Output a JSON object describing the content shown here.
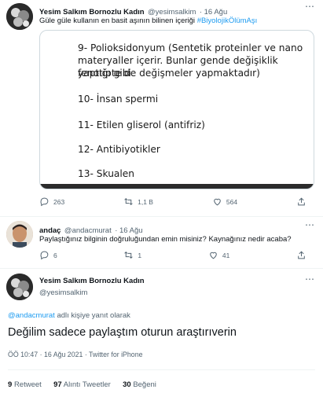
{
  "tweet1": {
    "author_name": "Yesim Salkım Bornozlu Kadın",
    "author_handle": "@yesimsalkim",
    "date_sep": "· 16 Ağu",
    "text": "Güle güle kullanın en basit aşının bilinen içeriği",
    "hashtag": "#BiyolojikÖlümAşı",
    "image_lines": [
      "9- Polioksidonyum (Sentetik proteinler ve nano",
      "materyaller içerir. Bunlar gende değişiklik yaptığı gibi",
      "fenotipte de değişmeler yapmaktadır)",
      "10- İnsan spermi",
      "11- Etilen gliserol (antifriz)",
      "12- Antibiyotikler",
      "13- Skualen"
    ],
    "replies": "263",
    "retweets": "1,1 B",
    "likes": "564"
  },
  "tweet2": {
    "author_name": "andaç",
    "author_handle": "@andacmurat",
    "date_sep": "· 16 Ağu",
    "text": "Paylaştığınız bilginin doğruluğundan emin misiniz? Kaynağınız nedir acaba?",
    "replies": "6",
    "retweets": "1",
    "likes": "41"
  },
  "tweet3": {
    "author_name": "Yesim Salkım Bornozlu Kadın",
    "author_handle": "@yesimsalkim",
    "reply_to_handle": "@andacmurat",
    "reply_to_suffix": "adlı kişiye yanıt olarak",
    "text": "Değilim sadece paylaştım oturun araştırıverin",
    "timestamp": "ÖÖ 10:47 · 16 Ağu 2021 · Twitter for iPhone",
    "retweets_count": "9",
    "retweets_label": "Retweet",
    "quotes_count": "97",
    "quotes_label": "Alıntı Tweetler",
    "likes_count": "30",
    "likes_label": "Beğeni"
  },
  "colors": {
    "accent": "#1d9bf0",
    "muted": "#536471",
    "text": "#0f1419"
  }
}
